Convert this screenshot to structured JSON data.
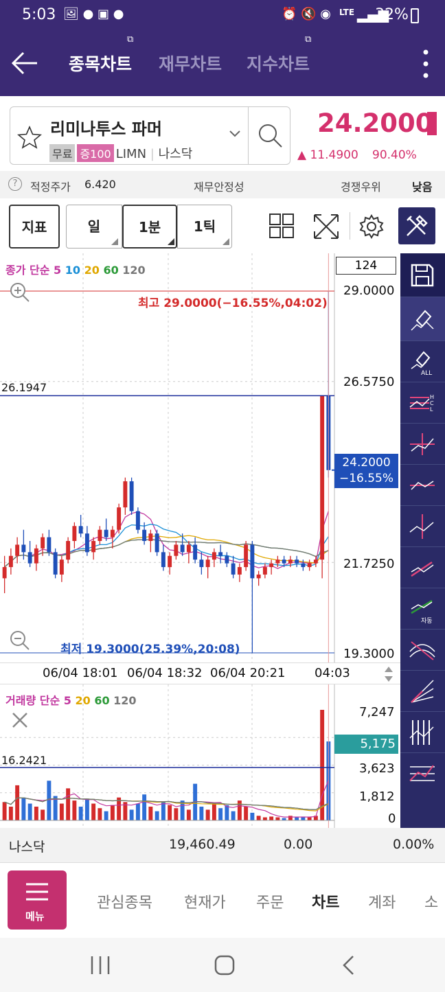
{
  "status": {
    "time": "5:03",
    "battery": "32%",
    "network": "LTE"
  },
  "appbar": {
    "tabs": [
      {
        "label": "종목차트",
        "active": true
      },
      {
        "label": "재무차트",
        "active": false
      },
      {
        "label": "지수차트",
        "active": false
      }
    ]
  },
  "stock": {
    "name": "리미나투스 파머",
    "tags": [
      "무료",
      "증100"
    ],
    "ticker": "LIMN",
    "market": "나스닥",
    "price": "24.2000",
    "change": "▲ 11.4900",
    "change_pct": "90.40%"
  },
  "info": {
    "fair_label": "적정주가",
    "fair_value": "6.420",
    "fin_label": "재무안정성",
    "comp_label": "경쟁우위",
    "level": "낮음"
  },
  "toolbar": {
    "indicator": "지표",
    "periods": [
      {
        "label": "일",
        "selected": false
      },
      {
        "label": "1분",
        "selected": true
      },
      {
        "label": "1틱",
        "selected": false
      }
    ]
  },
  "chart_data": {
    "type": "candlestick",
    "price_legend": {
      "prefix": "종가 단순",
      "periods": [
        "5",
        "10",
        "20",
        "60",
        "120"
      ],
      "colors": [
        "#c1379f",
        "#1a8fd6",
        "#e0a800",
        "#2c9a38",
        "#777777"
      ]
    },
    "volume_legend": {
      "prefix": "거래량 단순",
      "periods": [
        "5",
        "20",
        "60",
        "120"
      ],
      "colors": [
        "#c1379f",
        "#e0a800",
        "#2c9a38",
        "#777777"
      ]
    },
    "count_box": "124",
    "y_ticks": [
      "29.0000",
      "26.5750",
      "21.7250",
      "19.3000"
    ],
    "ylim": [
      19.3,
      29.0
    ],
    "high_label": "최고 29.0000(−16.55%,04:02)",
    "low_label": "최저 19.3000(25.39%,20:08)",
    "ref_line_label": "26.1947",
    "ref_line_value": 26.1947,
    "current_price_label": "24.2000",
    "current_pct_label": "−16.55%",
    "current_value": 24.2,
    "x_ticks": [
      "06/04 18:01",
      "06/04 18:32",
      "06/04 20:21",
      "04:03"
    ],
    "vol_y_ticks": [
      "7,247",
      "3,623",
      "1,812",
      "0"
    ],
    "vol_ylim": [
      0,
      7247
    ],
    "vol_current": "5,175",
    "vol_ref_label": "16.2421",
    "candles_ohlc": [
      [
        21.3,
        21.9,
        20.9,
        21.6
      ],
      [
        21.6,
        22.1,
        21.4,
        21.9
      ],
      [
        21.9,
        22.4,
        21.7,
        22.2
      ],
      [
        22.2,
        22.6,
        21.8,
        22.0
      ],
      [
        22.0,
        22.3,
        21.6,
        21.7
      ],
      [
        21.7,
        22.2,
        21.5,
        22.1
      ],
      [
        22.1,
        22.5,
        21.9,
        22.4
      ],
      [
        22.4,
        22.6,
        21.9,
        22.0
      ],
      [
        22.0,
        22.1,
        21.3,
        21.4
      ],
      [
        21.4,
        21.9,
        21.2,
        21.8
      ],
      [
        21.8,
        22.4,
        21.7,
        22.3
      ],
      [
        22.3,
        22.8,
        22.1,
        22.7
      ],
      [
        22.7,
        23.0,
        22.4,
        22.5
      ],
      [
        22.5,
        22.7,
        21.9,
        22.0
      ],
      [
        22.0,
        22.4,
        21.8,
        22.3
      ],
      [
        22.3,
        22.7,
        22.2,
        22.6
      ],
      [
        22.6,
        22.9,
        22.3,
        22.4
      ],
      [
        22.4,
        22.7,
        22.1,
        22.6
      ],
      [
        22.6,
        23.3,
        22.5,
        23.2
      ],
      [
        23.2,
        24.0,
        23.0,
        23.9
      ],
      [
        23.9,
        24.0,
        23.0,
        23.1
      ],
      [
        23.1,
        23.2,
        22.5,
        22.6
      ],
      [
        22.6,
        22.8,
        22.2,
        22.3
      ],
      [
        22.3,
        22.6,
        22.0,
        22.5
      ],
      [
        22.5,
        22.6,
        21.9,
        22.0
      ],
      [
        22.0,
        22.2,
        21.5,
        21.6
      ],
      [
        21.6,
        22.0,
        21.4,
        21.9
      ],
      [
        21.9,
        22.3,
        21.8,
        22.2
      ],
      [
        22.2,
        22.5,
        21.9,
        22.0
      ],
      [
        22.0,
        22.3,
        21.7,
        22.2
      ],
      [
        22.2,
        22.4,
        21.7,
        21.8
      ],
      [
        21.8,
        22.0,
        21.4,
        21.6
      ],
      [
        21.6,
        21.9,
        21.3,
        21.8
      ],
      [
        21.8,
        22.1,
        21.6,
        22.0
      ],
      [
        22.0,
        22.2,
        21.7,
        21.9
      ],
      [
        21.9,
        22.0,
        21.6,
        21.7
      ],
      [
        21.7,
        21.9,
        21.3,
        21.4
      ],
      [
        21.4,
        21.7,
        21.2,
        21.6
      ],
      [
        21.6,
        22.3,
        21.5,
        22.2
      ],
      [
        22.2,
        22.3,
        19.3,
        21.3
      ],
      [
        21.3,
        21.5,
        21.1,
        21.4
      ],
      [
        21.4,
        21.7,
        21.3,
        21.6
      ],
      [
        21.6,
        21.8,
        21.4,
        21.7
      ],
      [
        21.7,
        21.9,
        21.6,
        21.8
      ],
      [
        21.8,
        21.9,
        21.6,
        21.7
      ],
      [
        21.7,
        21.9,
        21.6,
        21.8
      ],
      [
        21.8,
        21.9,
        21.6,
        21.7
      ],
      [
        21.7,
        21.8,
        21.5,
        21.6
      ],
      [
        21.6,
        21.8,
        21.5,
        21.7
      ],
      [
        21.7,
        21.9,
        21.6,
        21.8
      ],
      [
        21.8,
        26.2,
        21.3,
        26.2
      ],
      [
        26.2,
        29.0,
        24.0,
        24.2
      ]
    ],
    "volumes": [
      1200,
      900,
      2300,
      1500,
      1100,
      900,
      700,
      2600,
      1600,
      1100,
      2100,
      1300,
      900,
      1400,
      1100,
      800,
      600,
      1000,
      1500,
      1200,
      700,
      1100,
      1700,
      900,
      600,
      1200,
      1000,
      800,
      1300,
      700,
      2400,
      900,
      700,
      1100,
      800,
      1000,
      600,
      1300,
      900,
      500,
      300,
      200,
      250,
      200,
      150,
      300,
      200,
      250,
      200,
      300,
      7247,
      5175
    ]
  },
  "nasdaq": {
    "label": "나스닥",
    "value": "19,460.49",
    "change": "0.00",
    "pct": "0.00%"
  },
  "bottomnav": {
    "menu_label": "메뉴",
    "items": [
      "관심종목",
      "현재가",
      "주문",
      "차트",
      "계좌",
      "소"
    ],
    "active": "차트"
  }
}
